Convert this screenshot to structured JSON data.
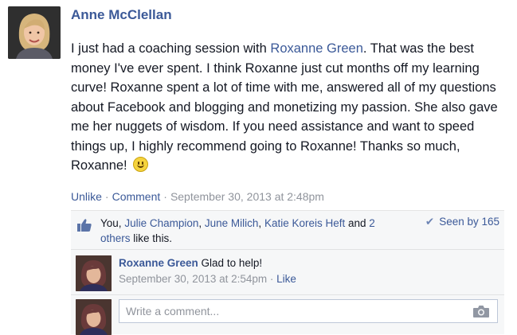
{
  "post": {
    "author": "Anne McClellan",
    "text_before_mention": "I just had a coaching session with ",
    "mention": "Roxanne Green",
    "text_after_mention": ". That was the best money I've ever spent. I think Roxanne just cut months off my learning curve! Roxanne spent a lot of time with me, answered all of my questions about Facebook and blogging and monetizing my passion. She also gave me her nuggets of wisdom. If you need assistance and want to speed things up, I highly recommend going to Roxanne! Thanks so much, Roxanne!",
    "emoticon": "smiley-icon"
  },
  "actions": {
    "unlike": "Unlike",
    "comment": "Comment",
    "timestamp": "September 30, 2013 at 2:48pm"
  },
  "likes": {
    "you": "You,",
    "names": [
      "Julie Champion",
      "June Milich",
      "Katie Koreis Heft"
    ],
    "and": "and",
    "others": "2 others",
    "suffix": "like this.",
    "seen": "Seen by 165"
  },
  "comments": [
    {
      "author": "Roxanne Green",
      "text": "Glad to help!",
      "timestamp": "September 30, 2013 at 2:54pm",
      "like": "Like"
    }
  ],
  "write_comment": {
    "placeholder": "Write a comment..."
  },
  "colors": {
    "link": "#3b5998",
    "meta": "#90949c",
    "ufi_bg": "#f6f7f8"
  }
}
